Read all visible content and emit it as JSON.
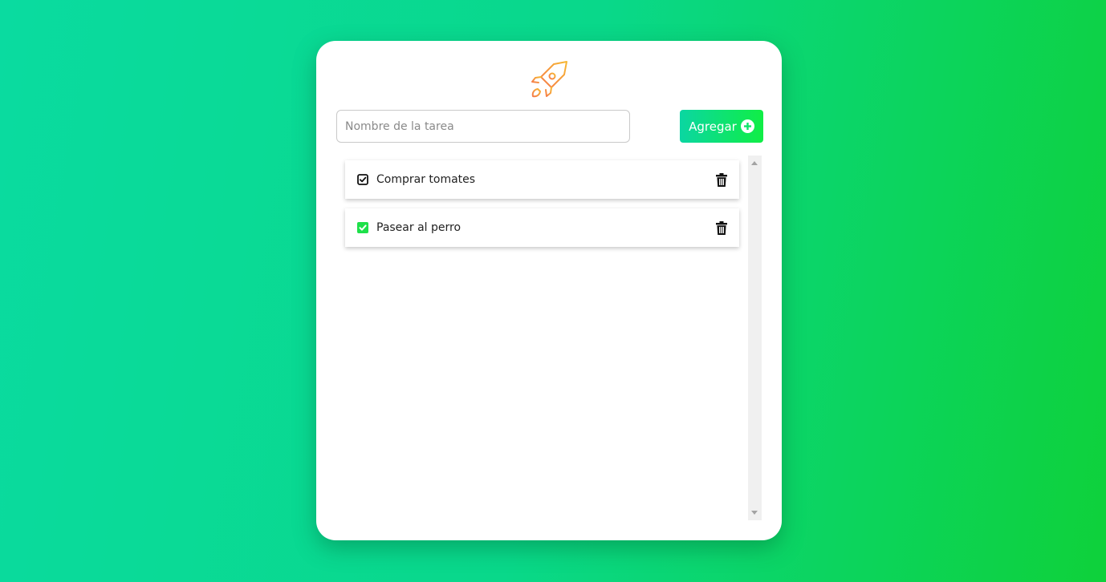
{
  "logo": {
    "icon": "rocket-icon",
    "colors": [
      "#f7b731",
      "#f57c4b"
    ]
  },
  "form": {
    "input_value": "",
    "input_placeholder": "Nombre de la tarea",
    "add_button_label": "Agregar",
    "add_button_icon": "plus-circle-icon"
  },
  "tasks": [
    {
      "label": "Comprar tomates",
      "completed": false,
      "check_icon": "checkbox-checked-outline-icon",
      "delete_icon": "trash-icon"
    },
    {
      "label": "Pasear al perro",
      "completed": true,
      "check_icon": "checkbox-checked-filled-icon",
      "delete_icon": "trash-icon"
    }
  ],
  "colors": {
    "background_start": "#0adba0",
    "background_end": "#0ed13a",
    "accent_green": "#10ee45",
    "accent_teal": "#0bd6a2",
    "done_check": "#1ee04a"
  }
}
